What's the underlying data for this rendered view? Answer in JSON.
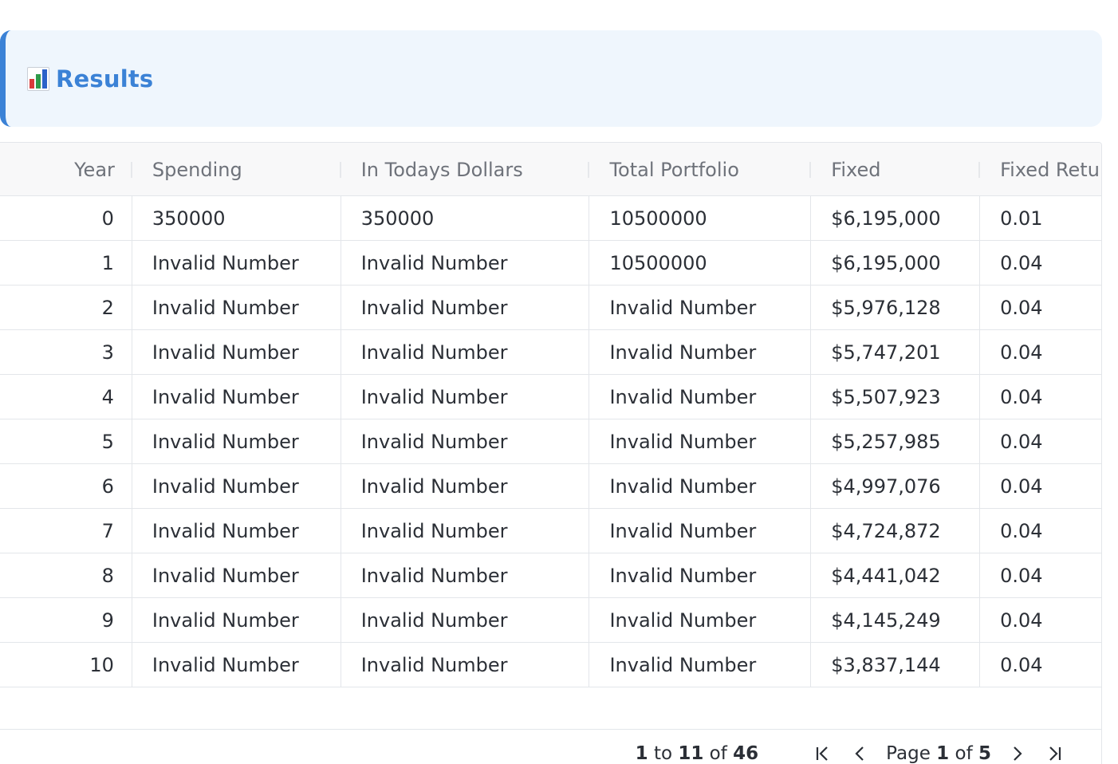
{
  "banner": {
    "title": "Results",
    "icon": "bar-chart-icon"
  },
  "table": {
    "columns": [
      "Year",
      "Spending",
      "In Todays Dollars",
      "Total Portfolio",
      "Fixed",
      "Fixed Return"
    ],
    "rows": [
      [
        "0",
        "350000",
        "350000",
        "10500000",
        "$6,195,000",
        "0.01"
      ],
      [
        "1",
        "Invalid Number",
        "Invalid Number",
        "10500000",
        "$6,195,000",
        "0.04"
      ],
      [
        "2",
        "Invalid Number",
        "Invalid Number",
        "Invalid Number",
        "$5,976,128",
        "0.04"
      ],
      [
        "3",
        "Invalid Number",
        "Invalid Number",
        "Invalid Number",
        "$5,747,201",
        "0.04"
      ],
      [
        "4",
        "Invalid Number",
        "Invalid Number",
        "Invalid Number",
        "$5,507,923",
        "0.04"
      ],
      [
        "5",
        "Invalid Number",
        "Invalid Number",
        "Invalid Number",
        "$5,257,985",
        "0.04"
      ],
      [
        "6",
        "Invalid Number",
        "Invalid Number",
        "Invalid Number",
        "$4,997,076",
        "0.04"
      ],
      [
        "7",
        "Invalid Number",
        "Invalid Number",
        "Invalid Number",
        "$4,724,872",
        "0.04"
      ],
      [
        "8",
        "Invalid Number",
        "Invalid Number",
        "Invalid Number",
        "$4,441,042",
        "0.04"
      ],
      [
        "9",
        "Invalid Number",
        "Invalid Number",
        "Invalid Number",
        "$4,145,249",
        "0.04"
      ],
      [
        "10",
        "Invalid Number",
        "Invalid Number",
        "Invalid Number",
        "$3,837,144",
        "0.04"
      ]
    ]
  },
  "pagination": {
    "from": "1",
    "to_word": "to",
    "to": "11",
    "of_word": "of",
    "total": "46",
    "page_word": "Page",
    "page": "1",
    "page_of_word": "of",
    "page_count": "5"
  },
  "colors": {
    "accent": "#3b82d6",
    "banner_bg": "#eff6fd"
  }
}
